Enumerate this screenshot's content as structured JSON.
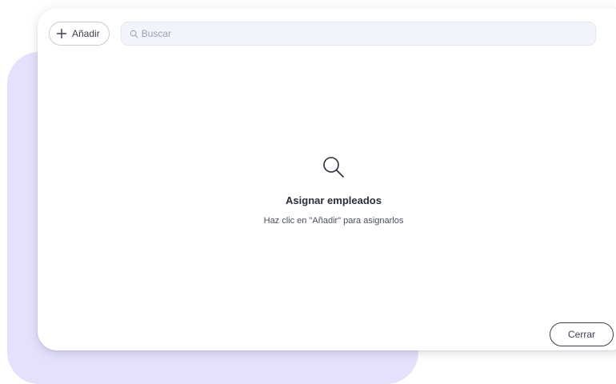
{
  "toolbar": {
    "add_label": "Añadir",
    "add_icon": "plus-icon",
    "search_placeholder": "Buscar",
    "search_value": "",
    "search_icon": "search-icon"
  },
  "empty_state": {
    "icon": "search-icon",
    "title": "Asignar empleados",
    "text": "Haz clic en \"Añadir\" para asignarlos"
  },
  "footer": {
    "close_label": "Cerrar"
  },
  "colors": {
    "backdrop": "#e3e1fb",
    "panel": "#ffffff",
    "search_bg": "#f1f4fa",
    "text_dark": "#2a2e3d",
    "button_border": "#3b3f4c"
  }
}
